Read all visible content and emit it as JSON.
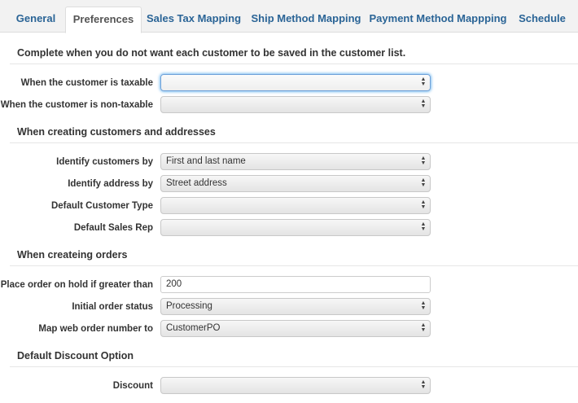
{
  "tabs": [
    {
      "label": "General",
      "active": false
    },
    {
      "label": "Preferences",
      "active": true
    },
    {
      "label": "Sales Tax Mapping",
      "active": false
    },
    {
      "label": "Ship Method Mapping",
      "active": false
    },
    {
      "label": "Payment Method Mappping",
      "active": false
    },
    {
      "label": "Schedule",
      "active": false
    }
  ],
  "sections": {
    "no_save": {
      "title": "Complete when you do not want each customer to be saved in the customer list.",
      "taxable_label": "When the customer is taxable",
      "taxable_value": "",
      "nontaxable_label": "When the customer is non-taxable",
      "nontaxable_value": ""
    },
    "creating": {
      "title": "When creating customers and addresses",
      "identify_customers_label": "Identify customers by",
      "identify_customers_value": "First and last name",
      "identify_address_label": "Identify address by",
      "identify_address_value": "Street address",
      "customer_type_label": "Default Customer Type",
      "customer_type_value": "",
      "sales_rep_label": "Default Sales Rep",
      "sales_rep_value": ""
    },
    "orders": {
      "title": "When createing orders",
      "hold_label": "Place order on hold if greater than",
      "hold_value": "200",
      "status_label": "Initial order status",
      "status_value": "Processing",
      "map_label": "Map web order number to",
      "map_value": "CustomerPO"
    },
    "discount": {
      "title": "Default Discount Option",
      "discount_label": "Discount",
      "discount_value": ""
    }
  },
  "icons": {
    "select_caret": "up-down-chevron-icon"
  },
  "colors": {
    "tab_link": "#2a6496",
    "focus_ring": "#52a8ec"
  }
}
